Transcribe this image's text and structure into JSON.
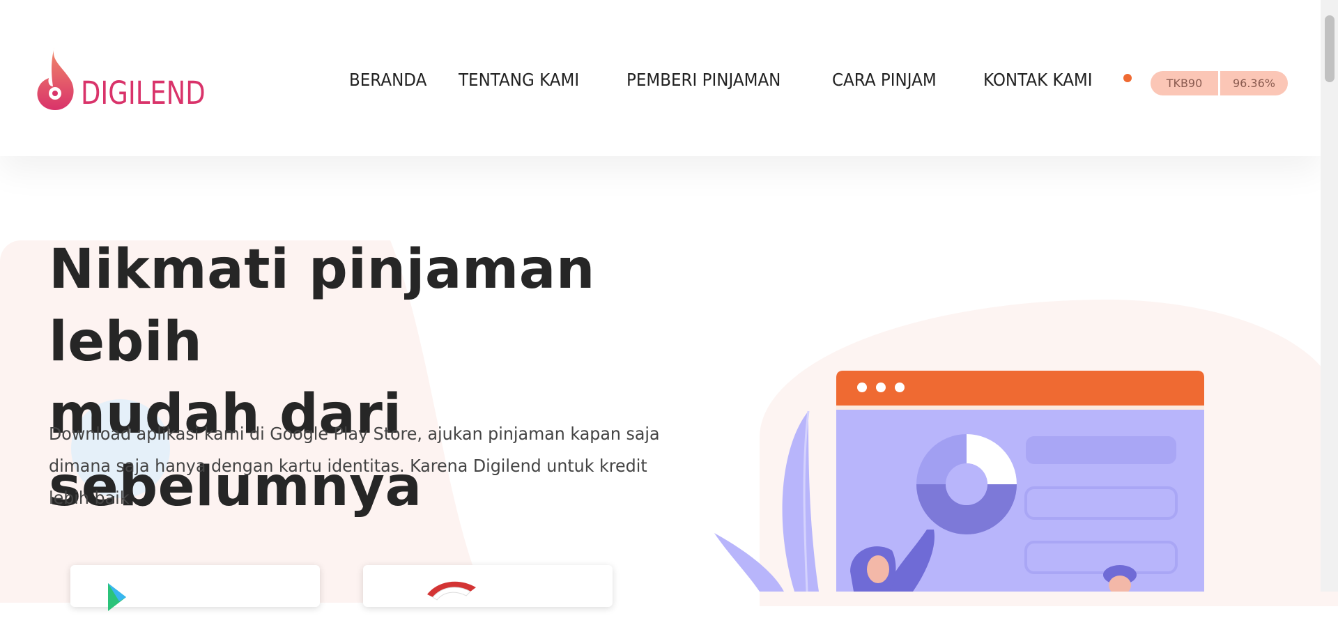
{
  "brand": {
    "name": "DIGILEND",
    "color": "#d9336a"
  },
  "nav": {
    "items": [
      {
        "label": "BERANDA"
      },
      {
        "label": "TENTANG KAMI"
      },
      {
        "label": "PEMBERI PINJAMAN"
      },
      {
        "label": "CARA PINJAM"
      },
      {
        "label": "KONTAK KAMI"
      }
    ],
    "indicator_color": "#ef6a32"
  },
  "tkb": {
    "label": "TKB90",
    "value": "96.36%"
  },
  "hero": {
    "title_line1": "Nikmati pinjaman lebih",
    "title_line2": "mudah dari sebelumnya",
    "description": "Download aplikasi kami di Google Play Store, ajukan pinjaman kapan saja dimana saja hanya dengan kartu identitas. Karena Digilend untuk kredit lebih baik"
  },
  "store_buttons": [
    {
      "icon": "google-play-icon"
    },
    {
      "icon": "garuda-badge-icon"
    }
  ],
  "colors": {
    "accent": "#ef6a32",
    "illustration_purple": "#b8b5fb",
    "tkb_bg": "#fbc6b6"
  }
}
